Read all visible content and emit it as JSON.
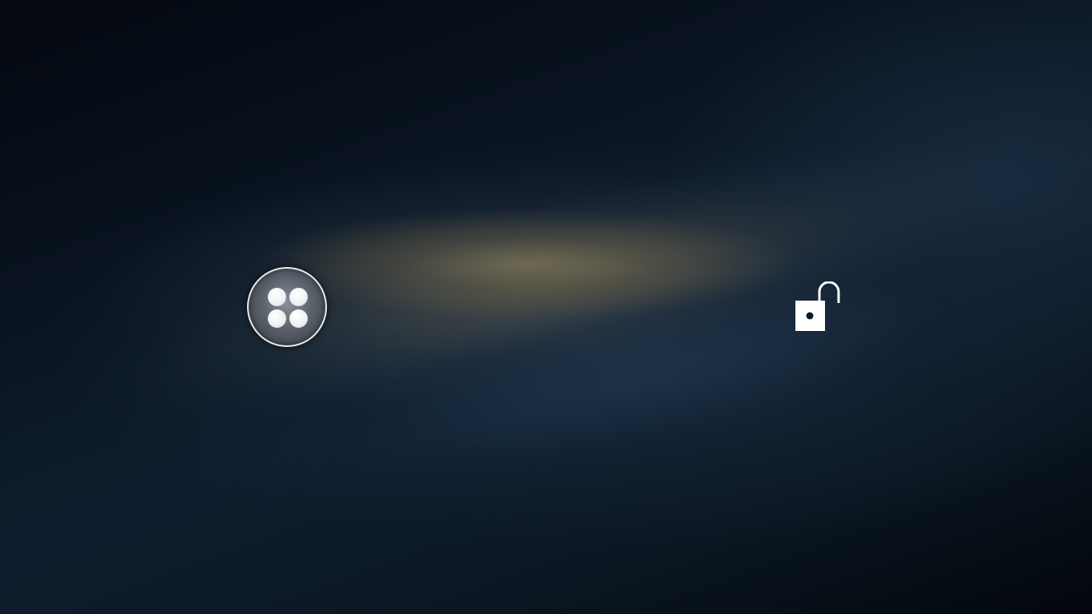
{
  "screen": {
    "type": "lock screen",
    "wallpaper": "blurred galaxy",
    "colors": {
      "background_dark": "#050a12",
      "background_blue": "#1c3148",
      "glow": "#7c7556",
      "icon_white": "#ffffff"
    }
  },
  "launcher": {
    "icon": "four-dots-app-launcher-icon"
  },
  "unlock": {
    "icon": "unlocked-padlock-icon"
  }
}
